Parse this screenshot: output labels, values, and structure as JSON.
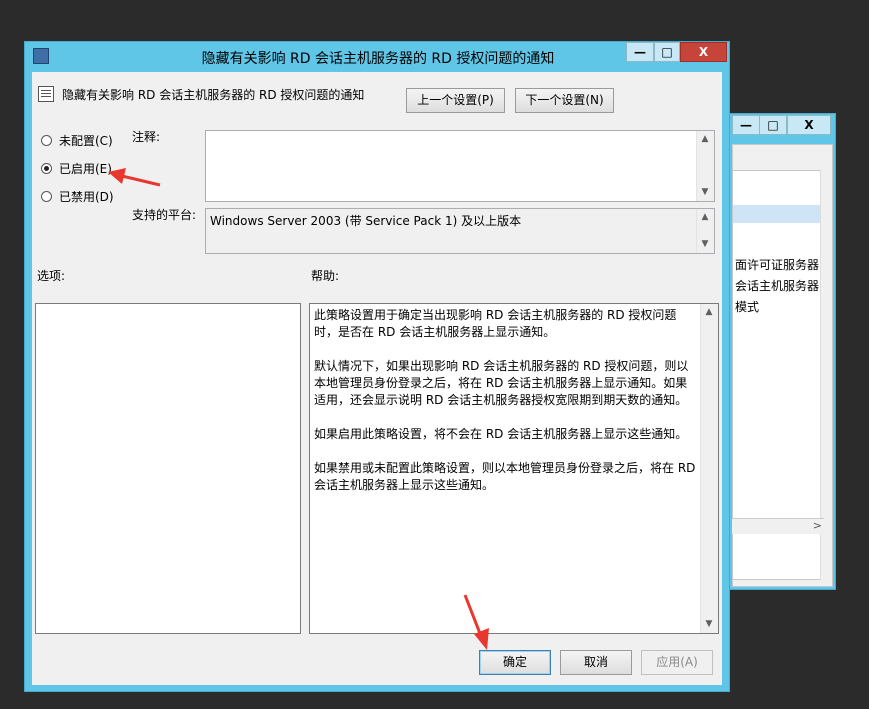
{
  "background_window": {
    "minimize": "—",
    "maximize": "□",
    "close": "X",
    "list_items": [
      "面许可证服务器",
      "会话主机服务器的",
      "模式"
    ],
    "scroll_right": ">"
  },
  "window": {
    "title": "隐藏有关影响 RD 会话主机服务器的 RD 授权问题的通知",
    "minimize": "—",
    "maximize": "□",
    "close": "X"
  },
  "header": {
    "policy_name": "隐藏有关影响 RD 会话主机服务器的 RD 授权问题的通知",
    "prev_button": "上一个设置(P)",
    "next_button": "下一个设置(N)"
  },
  "state": {
    "options": [
      {
        "label": "未配置(C)",
        "selected": false
      },
      {
        "label": "已启用(E)",
        "selected": true
      },
      {
        "label": "已禁用(D)",
        "selected": false
      }
    ]
  },
  "comment": {
    "label": "注释:",
    "value": ""
  },
  "supported": {
    "label": "支持的平台:",
    "value": "Windows Server 2003 (带 Service Pack 1) 及以上版本"
  },
  "options_label": "选项:",
  "help_label": "帮助:",
  "help_paragraphs": [
    "此策略设置用于确定当出现影响 RD 会话主机服务器的 RD 授权问题时，是否在 RD 会话主机服务器上显示通知。",
    "默认情况下，如果出现影响 RD 会话主机服务器的 RD 授权问题，则以本地管理员身份登录之后，将在 RD 会话主机服务器上显示通知。如果适用，还会显示说明 RD 会话主机服务器授权宽限期到期天数的通知。",
    "如果启用此策略设置，将不会在 RD 会话主机服务器上显示这些通知。",
    "如果禁用或未配置此策略设置，则以本地管理员身份登录之后，将在 RD 会话主机服务器上显示这些通知。"
  ],
  "footer": {
    "ok": "确定",
    "cancel": "取消",
    "apply": "应用(A)"
  },
  "scroll": {
    "up": "▲",
    "down": "▼"
  },
  "colors": {
    "title_bar": "#5fc6e8",
    "close_button": "#c7443a",
    "annotation_arrow": "#e8372e"
  }
}
